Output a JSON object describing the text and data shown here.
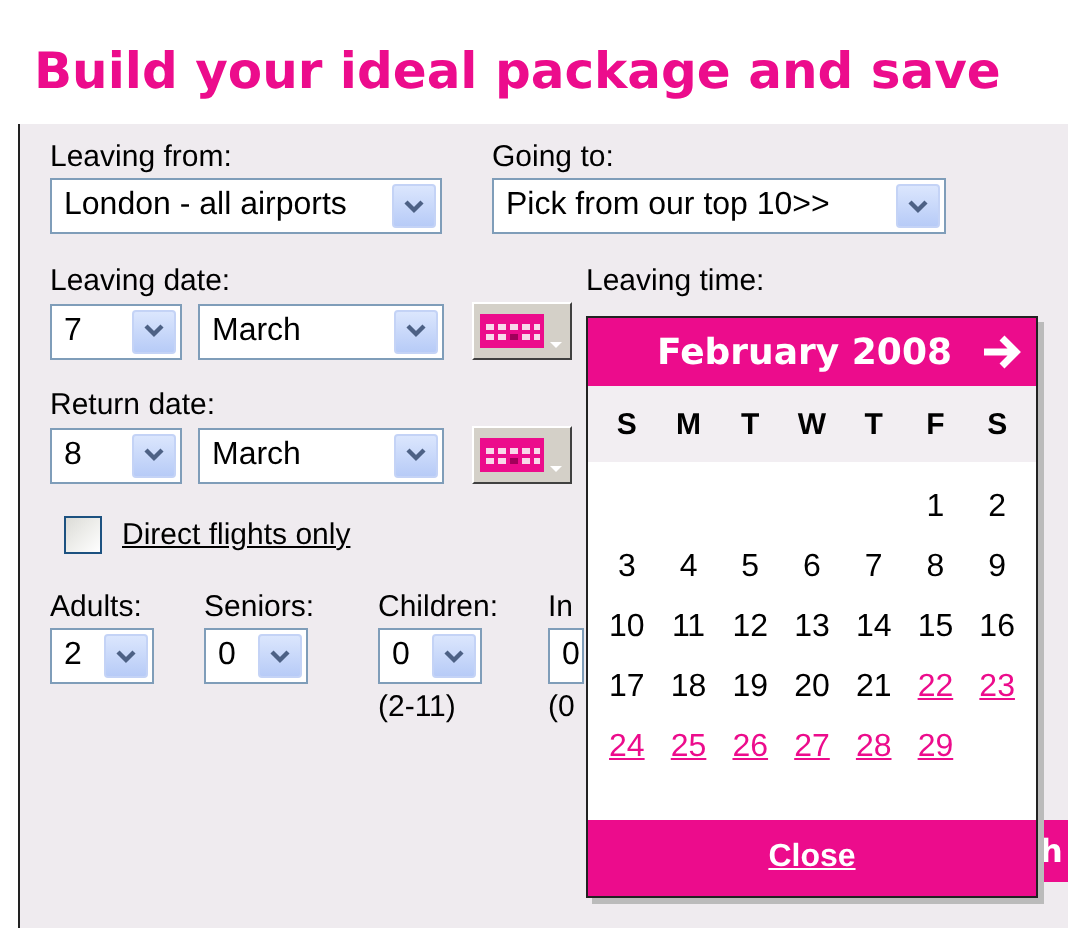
{
  "title": "Build your ideal package and save",
  "leaving_from": {
    "label": "Leaving from:",
    "value": "London - all airports"
  },
  "going_to": {
    "label": "Going to:",
    "value": "Pick from our top 10>>"
  },
  "leaving_date": {
    "label": "Leaving date:",
    "day": "7",
    "month": "March"
  },
  "leaving_time": {
    "label": "Leaving time:"
  },
  "return_date": {
    "label": "Return date:",
    "day": "8",
    "month": "March"
  },
  "direct_flights": {
    "label": "Direct flights only",
    "checked": false
  },
  "passengers": [
    {
      "label": "Adults:",
      "value": "2"
    },
    {
      "label": "Seniors:",
      "value": "0"
    },
    {
      "label": "Children:",
      "value": "0",
      "note": "(2-11)"
    },
    {
      "label": "In",
      "value": "0",
      "note": "(0"
    }
  ],
  "search_button": {
    "label": "h"
  },
  "calendar": {
    "month": "February 2008",
    "weekdays": [
      "S",
      "M",
      "T",
      "W",
      "T",
      "F",
      "S"
    ],
    "weeks": [
      [
        {
          "day": "1",
          "available": false
        },
        {
          "day": "2",
          "available": false
        }
      ],
      [
        {
          "day": "3",
          "available": false
        },
        {
          "day": "4",
          "available": false
        },
        {
          "day": "5",
          "available": false
        },
        {
          "day": "6",
          "available": false
        },
        {
          "day": "7",
          "available": false
        },
        {
          "day": "8",
          "available": false
        },
        {
          "day": "9",
          "available": false
        }
      ],
      [
        {
          "day": "10",
          "available": false
        },
        {
          "day": "11",
          "available": false
        },
        {
          "day": "12",
          "available": false
        },
        {
          "day": "13",
          "available": false
        },
        {
          "day": "14",
          "available": false
        },
        {
          "day": "15",
          "available": false
        },
        {
          "day": "16",
          "available": false
        }
      ],
      [
        {
          "day": "17",
          "available": false
        },
        {
          "day": "18",
          "available": false
        },
        {
          "day": "19",
          "available": false
        },
        {
          "day": "20",
          "available": false
        },
        {
          "day": "21",
          "available": false
        },
        {
          "day": "22",
          "available": true
        },
        {
          "day": "23",
          "available": true
        }
      ],
      [
        {
          "day": "24",
          "available": true
        },
        {
          "day": "25",
          "available": true
        },
        {
          "day": "26",
          "available": true
        },
        {
          "day": "27",
          "available": true
        },
        {
          "day": "28",
          "available": true
        },
        {
          "day": "29",
          "available": true
        }
      ]
    ],
    "close": "Close"
  }
}
